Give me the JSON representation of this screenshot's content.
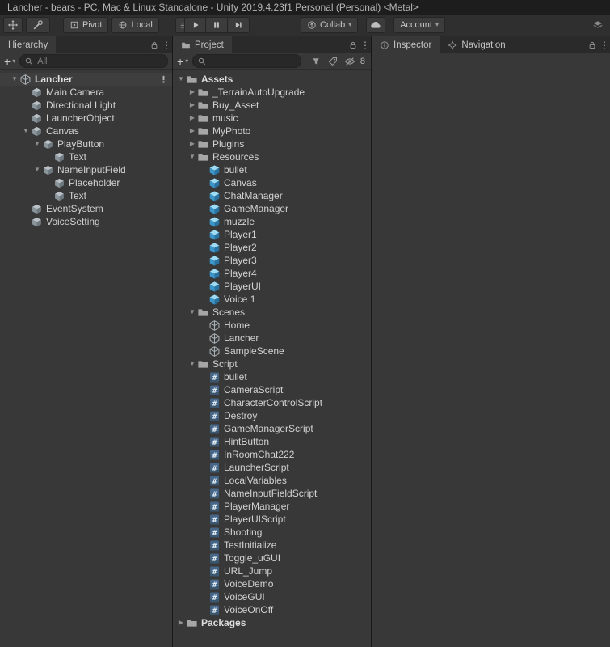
{
  "window": {
    "title": "Lancher - bears - PC, Mac & Linux Standalone - Unity 2019.4.23f1 Personal (Personal) <Metal>"
  },
  "toolbar": {
    "pivot_label": "Pivot",
    "local_label": "Local",
    "collab_label": "Collab",
    "account_label": "Account",
    "icon_buttons": [
      "move-tool-icon",
      "custom-tools-icon",
      "pivot-icon",
      "local-icon",
      "grid-snapping-icon",
      "play-icon",
      "pause-icon",
      "step-icon",
      "collab-icon",
      "cloud-icon",
      "layers-icon"
    ]
  },
  "hierarchy": {
    "tab_label": "Hierarchy",
    "search_placeholder": "All",
    "header_icons": [
      "lock-icon",
      "menu-icon"
    ],
    "items": [
      {
        "label": "Lancher",
        "depth": 0,
        "icon": "unity-scene",
        "arrow": "open",
        "kind": "scene-header"
      },
      {
        "label": "Main Camera",
        "depth": 1,
        "icon": "camera",
        "arrow": "none"
      },
      {
        "label": "Directional Light",
        "depth": 1,
        "icon": "light",
        "arrow": "none"
      },
      {
        "label": "LauncherObject",
        "depth": 1,
        "icon": "gameobject",
        "arrow": "none"
      },
      {
        "label": "Canvas",
        "depth": 1,
        "icon": "canvas",
        "arrow": "open"
      },
      {
        "label": "PlayButton",
        "depth": 2,
        "icon": "button",
        "arrow": "open"
      },
      {
        "label": "Text",
        "depth": 3,
        "icon": "text",
        "arrow": "none"
      },
      {
        "label": "NameInputField",
        "depth": 2,
        "icon": "input-field",
        "arrow": "open"
      },
      {
        "label": "Placeholder",
        "depth": 3,
        "icon": "text",
        "arrow": "none"
      },
      {
        "label": "Text",
        "depth": 3,
        "icon": "text",
        "arrow": "none"
      },
      {
        "label": "EventSystem",
        "depth": 1,
        "icon": "event-system",
        "arrow": "none"
      },
      {
        "label": "VoiceSetting",
        "depth": 1,
        "icon": "voice-setting",
        "arrow": "none"
      }
    ]
  },
  "project": {
    "tab_label": "Project",
    "search_value": "",
    "hidden_count": "8",
    "toolbar_icons": [
      "search-by-type-icon",
      "search-by-label-icon",
      "hidden-packages-icon"
    ],
    "items": [
      {
        "label": "Assets",
        "depth": 0,
        "icon": "folder",
        "arrow": "open",
        "bold": true
      },
      {
        "label": "_TerrainAutoUpgrade",
        "depth": 1,
        "icon": "folder",
        "arrow": "closed"
      },
      {
        "label": "Buy_Asset",
        "depth": 1,
        "icon": "folder",
        "arrow": "closed"
      },
      {
        "label": "music",
        "depth": 1,
        "icon": "folder",
        "arrow": "closed"
      },
      {
        "label": "MyPhoto",
        "depth": 1,
        "icon": "folder",
        "arrow": "closed"
      },
      {
        "label": "Plugins",
        "depth": 1,
        "icon": "folder",
        "arrow": "closed"
      },
      {
        "label": "Resources",
        "depth": 1,
        "icon": "folder",
        "arrow": "open"
      },
      {
        "label": "bullet",
        "depth": 2,
        "icon": "prefab",
        "arrow": "none"
      },
      {
        "label": "Canvas",
        "depth": 2,
        "icon": "prefab",
        "arrow": "none"
      },
      {
        "label": "ChatManager",
        "depth": 2,
        "icon": "prefab",
        "arrow": "none"
      },
      {
        "label": "GameManager",
        "depth": 2,
        "icon": "prefab",
        "arrow": "none"
      },
      {
        "label": "muzzle",
        "depth": 2,
        "icon": "prefab",
        "arrow": "none"
      },
      {
        "label": "Player1",
        "depth": 2,
        "icon": "prefab",
        "arrow": "none"
      },
      {
        "label": "Player2",
        "depth": 2,
        "icon": "prefab",
        "arrow": "none"
      },
      {
        "label": "Player3",
        "depth": 2,
        "icon": "prefab",
        "arrow": "none"
      },
      {
        "label": "Player4",
        "depth": 2,
        "icon": "prefab",
        "arrow": "none"
      },
      {
        "label": "PlayerUI",
        "depth": 2,
        "icon": "prefab",
        "arrow": "none"
      },
      {
        "label": "Voice 1",
        "depth": 2,
        "icon": "prefab",
        "arrow": "none"
      },
      {
        "label": "Scenes",
        "depth": 1,
        "icon": "folder",
        "arrow": "open"
      },
      {
        "label": "Home",
        "depth": 2,
        "icon": "scene",
        "arrow": "none"
      },
      {
        "label": "Lancher",
        "depth": 2,
        "icon": "scene",
        "arrow": "none"
      },
      {
        "label": "SampleScene",
        "depth": 2,
        "icon": "scene",
        "arrow": "none"
      },
      {
        "label": "Script",
        "depth": 1,
        "icon": "folder",
        "arrow": "open"
      },
      {
        "label": "bullet",
        "depth": 2,
        "icon": "script",
        "arrow": "none"
      },
      {
        "label": "CameraScript",
        "depth": 2,
        "icon": "script",
        "arrow": "none"
      },
      {
        "label": "CharacterControlScript",
        "depth": 2,
        "icon": "script",
        "arrow": "none"
      },
      {
        "label": "Destroy",
        "depth": 2,
        "icon": "script",
        "arrow": "none"
      },
      {
        "label": "GameManagerScript",
        "depth": 2,
        "icon": "script",
        "arrow": "none"
      },
      {
        "label": "HintButton",
        "depth": 2,
        "icon": "script",
        "arrow": "none"
      },
      {
        "label": "InRoomChat222",
        "depth": 2,
        "icon": "script",
        "arrow": "none"
      },
      {
        "label": "LauncherScript",
        "depth": 2,
        "icon": "script",
        "arrow": "none"
      },
      {
        "label": "LocalVariables",
        "depth": 2,
        "icon": "script",
        "arrow": "none"
      },
      {
        "label": "NameInputFieldScript",
        "depth": 2,
        "icon": "script",
        "arrow": "none"
      },
      {
        "label": "PlayerManager",
        "depth": 2,
        "icon": "script",
        "arrow": "none"
      },
      {
        "label": "PlayerUIScript",
        "depth": 2,
        "icon": "script",
        "arrow": "none"
      },
      {
        "label": "Shooting",
        "depth": 2,
        "icon": "script",
        "arrow": "none"
      },
      {
        "label": "TestInitialize",
        "depth": 2,
        "icon": "script",
        "arrow": "none"
      },
      {
        "label": "Toggle_uGUI",
        "depth": 2,
        "icon": "script",
        "arrow": "none"
      },
      {
        "label": "URL_Jump",
        "depth": 2,
        "icon": "script",
        "arrow": "none"
      },
      {
        "label": "VoiceDemo",
        "depth": 2,
        "icon": "script",
        "arrow": "none"
      },
      {
        "label": "VoiceGUI",
        "depth": 2,
        "icon": "script",
        "arrow": "none"
      },
      {
        "label": "VoiceOnOff",
        "depth": 2,
        "icon": "script",
        "arrow": "none"
      },
      {
        "label": "Packages",
        "depth": 0,
        "icon": "folder",
        "arrow": "closed",
        "bold": true
      }
    ]
  },
  "inspector": {
    "tabs": [
      {
        "label": "Inspector",
        "icon": "info-icon"
      },
      {
        "label": "Navigation",
        "icon": "navigation-icon"
      }
    ]
  }
}
